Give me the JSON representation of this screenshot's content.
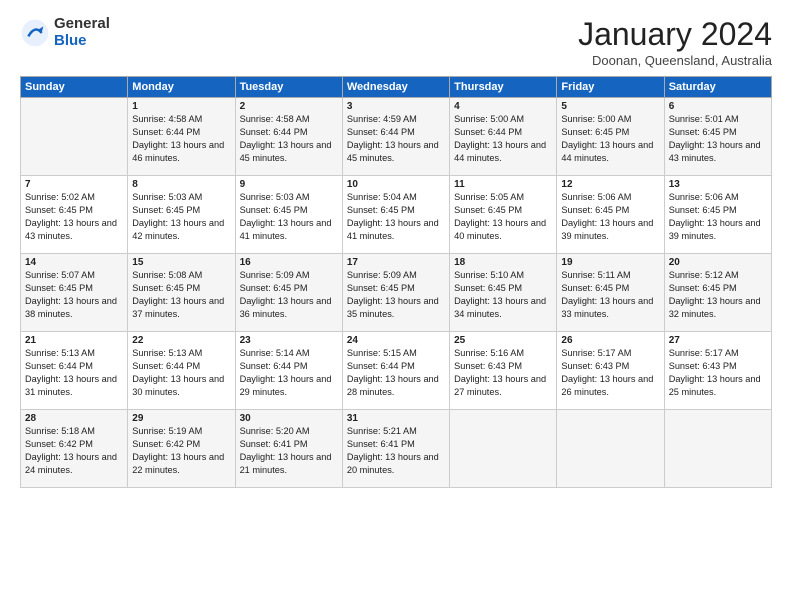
{
  "header": {
    "logo_general": "General",
    "logo_blue": "Blue",
    "month_title": "January 2024",
    "subtitle": "Doonan, Queensland, Australia"
  },
  "days_of_week": [
    "Sunday",
    "Monday",
    "Tuesday",
    "Wednesday",
    "Thursday",
    "Friday",
    "Saturday"
  ],
  "weeks": [
    [
      {
        "day": "",
        "sunrise": "",
        "sunset": "",
        "daylight": ""
      },
      {
        "day": "1",
        "sunrise": "Sunrise: 4:58 AM",
        "sunset": "Sunset: 6:44 PM",
        "daylight": "Daylight: 13 hours and 46 minutes."
      },
      {
        "day": "2",
        "sunrise": "Sunrise: 4:58 AM",
        "sunset": "Sunset: 6:44 PM",
        "daylight": "Daylight: 13 hours and 45 minutes."
      },
      {
        "day": "3",
        "sunrise": "Sunrise: 4:59 AM",
        "sunset": "Sunset: 6:44 PM",
        "daylight": "Daylight: 13 hours and 45 minutes."
      },
      {
        "day": "4",
        "sunrise": "Sunrise: 5:00 AM",
        "sunset": "Sunset: 6:44 PM",
        "daylight": "Daylight: 13 hours and 44 minutes."
      },
      {
        "day": "5",
        "sunrise": "Sunrise: 5:00 AM",
        "sunset": "Sunset: 6:45 PM",
        "daylight": "Daylight: 13 hours and 44 minutes."
      },
      {
        "day": "6",
        "sunrise": "Sunrise: 5:01 AM",
        "sunset": "Sunset: 6:45 PM",
        "daylight": "Daylight: 13 hours and 43 minutes."
      }
    ],
    [
      {
        "day": "7",
        "sunrise": "Sunrise: 5:02 AM",
        "sunset": "Sunset: 6:45 PM",
        "daylight": "Daylight: 13 hours and 43 minutes."
      },
      {
        "day": "8",
        "sunrise": "Sunrise: 5:03 AM",
        "sunset": "Sunset: 6:45 PM",
        "daylight": "Daylight: 13 hours and 42 minutes."
      },
      {
        "day": "9",
        "sunrise": "Sunrise: 5:03 AM",
        "sunset": "Sunset: 6:45 PM",
        "daylight": "Daylight: 13 hours and 41 minutes."
      },
      {
        "day": "10",
        "sunrise": "Sunrise: 5:04 AM",
        "sunset": "Sunset: 6:45 PM",
        "daylight": "Daylight: 13 hours and 41 minutes."
      },
      {
        "day": "11",
        "sunrise": "Sunrise: 5:05 AM",
        "sunset": "Sunset: 6:45 PM",
        "daylight": "Daylight: 13 hours and 40 minutes."
      },
      {
        "day": "12",
        "sunrise": "Sunrise: 5:06 AM",
        "sunset": "Sunset: 6:45 PM",
        "daylight": "Daylight: 13 hours and 39 minutes."
      },
      {
        "day": "13",
        "sunrise": "Sunrise: 5:06 AM",
        "sunset": "Sunset: 6:45 PM",
        "daylight": "Daylight: 13 hours and 39 minutes."
      }
    ],
    [
      {
        "day": "14",
        "sunrise": "Sunrise: 5:07 AM",
        "sunset": "Sunset: 6:45 PM",
        "daylight": "Daylight: 13 hours and 38 minutes."
      },
      {
        "day": "15",
        "sunrise": "Sunrise: 5:08 AM",
        "sunset": "Sunset: 6:45 PM",
        "daylight": "Daylight: 13 hours and 37 minutes."
      },
      {
        "day": "16",
        "sunrise": "Sunrise: 5:09 AM",
        "sunset": "Sunset: 6:45 PM",
        "daylight": "Daylight: 13 hours and 36 minutes."
      },
      {
        "day": "17",
        "sunrise": "Sunrise: 5:09 AM",
        "sunset": "Sunset: 6:45 PM",
        "daylight": "Daylight: 13 hours and 35 minutes."
      },
      {
        "day": "18",
        "sunrise": "Sunrise: 5:10 AM",
        "sunset": "Sunset: 6:45 PM",
        "daylight": "Daylight: 13 hours and 34 minutes."
      },
      {
        "day": "19",
        "sunrise": "Sunrise: 5:11 AM",
        "sunset": "Sunset: 6:45 PM",
        "daylight": "Daylight: 13 hours and 33 minutes."
      },
      {
        "day": "20",
        "sunrise": "Sunrise: 5:12 AM",
        "sunset": "Sunset: 6:45 PM",
        "daylight": "Daylight: 13 hours and 32 minutes."
      }
    ],
    [
      {
        "day": "21",
        "sunrise": "Sunrise: 5:13 AM",
        "sunset": "Sunset: 6:44 PM",
        "daylight": "Daylight: 13 hours and 31 minutes."
      },
      {
        "day": "22",
        "sunrise": "Sunrise: 5:13 AM",
        "sunset": "Sunset: 6:44 PM",
        "daylight": "Daylight: 13 hours and 30 minutes."
      },
      {
        "day": "23",
        "sunrise": "Sunrise: 5:14 AM",
        "sunset": "Sunset: 6:44 PM",
        "daylight": "Daylight: 13 hours and 29 minutes."
      },
      {
        "day": "24",
        "sunrise": "Sunrise: 5:15 AM",
        "sunset": "Sunset: 6:44 PM",
        "daylight": "Daylight: 13 hours and 28 minutes."
      },
      {
        "day": "25",
        "sunrise": "Sunrise: 5:16 AM",
        "sunset": "Sunset: 6:43 PM",
        "daylight": "Daylight: 13 hours and 27 minutes."
      },
      {
        "day": "26",
        "sunrise": "Sunrise: 5:17 AM",
        "sunset": "Sunset: 6:43 PM",
        "daylight": "Daylight: 13 hours and 26 minutes."
      },
      {
        "day": "27",
        "sunrise": "Sunrise: 5:17 AM",
        "sunset": "Sunset: 6:43 PM",
        "daylight": "Daylight: 13 hours and 25 minutes."
      }
    ],
    [
      {
        "day": "28",
        "sunrise": "Sunrise: 5:18 AM",
        "sunset": "Sunset: 6:42 PM",
        "daylight": "Daylight: 13 hours and 24 minutes."
      },
      {
        "day": "29",
        "sunrise": "Sunrise: 5:19 AM",
        "sunset": "Sunset: 6:42 PM",
        "daylight": "Daylight: 13 hours and 22 minutes."
      },
      {
        "day": "30",
        "sunrise": "Sunrise: 5:20 AM",
        "sunset": "Sunset: 6:41 PM",
        "daylight": "Daylight: 13 hours and 21 minutes."
      },
      {
        "day": "31",
        "sunrise": "Sunrise: 5:21 AM",
        "sunset": "Sunset: 6:41 PM",
        "daylight": "Daylight: 13 hours and 20 minutes."
      },
      {
        "day": "",
        "sunrise": "",
        "sunset": "",
        "daylight": ""
      },
      {
        "day": "",
        "sunrise": "",
        "sunset": "",
        "daylight": ""
      },
      {
        "day": "",
        "sunrise": "",
        "sunset": "",
        "daylight": ""
      }
    ]
  ]
}
